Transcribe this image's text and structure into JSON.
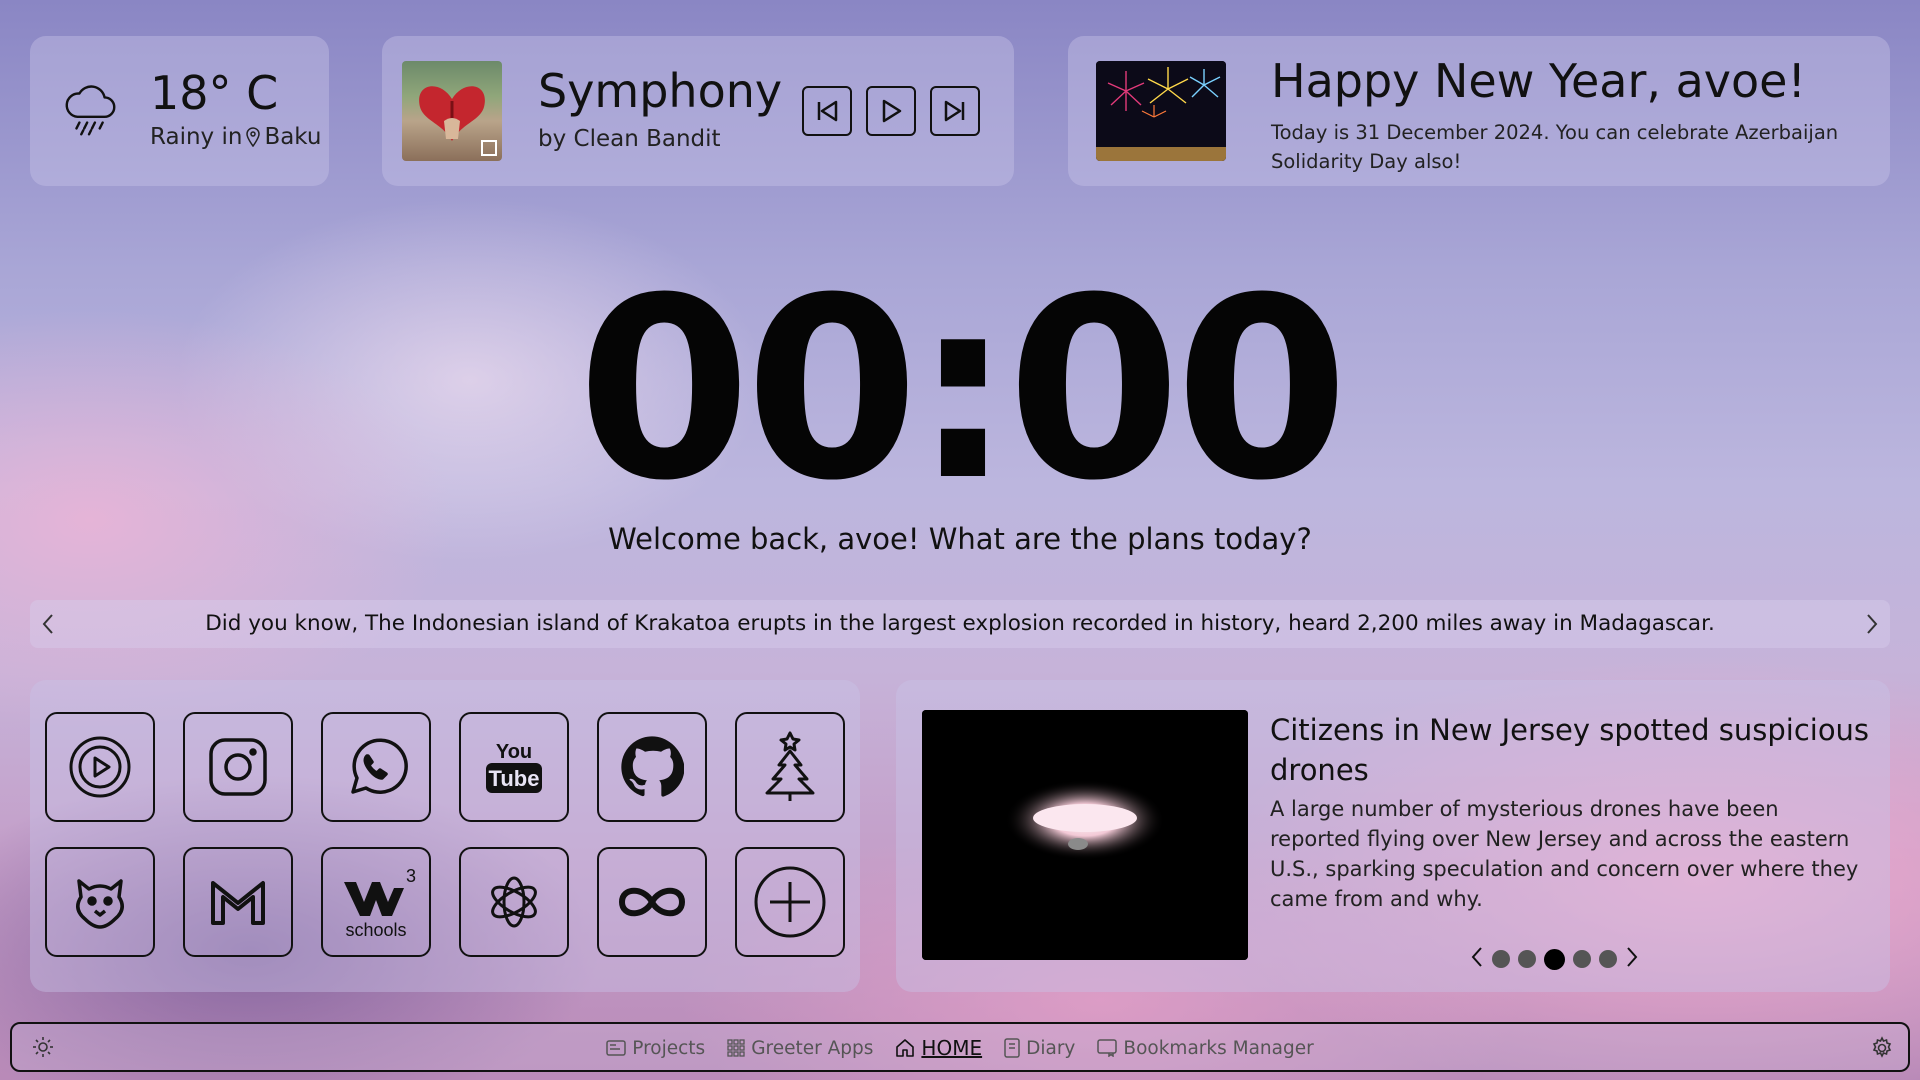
{
  "weather": {
    "temperature": "18° C",
    "condition": "Rainy in",
    "city": "Baku",
    "icon": "cloud-rain-icon"
  },
  "music": {
    "song": "Symphony",
    "artist": "by Clean Bandit",
    "controls": [
      "previous-icon",
      "play-icon",
      "next-icon"
    ]
  },
  "greeting": {
    "title": "Happy New Year, avoe!",
    "subtitle": "Today is 31 December 2024. You can celebrate Azerbaijan Solidarity Day also!"
  },
  "clock": {
    "time": "00:00",
    "welcome": "Welcome back, avoe! What are the plans today?"
  },
  "fact": {
    "text": "Did you know, The Indonesian island of Krakatoa erupts in the largest explosion recorded in history, heard 2,200 miles away in Madagascar."
  },
  "apps": {
    "row1": [
      "play-circle-icon",
      "instagram-icon",
      "whatsapp-icon",
      "youtube-icon",
      "github-icon",
      "christmas-tree-icon"
    ],
    "row2": [
      "bird-icon",
      "gmail-icon",
      "w3schools-icon",
      "openai-icon",
      "infinity-icon",
      "add-icon"
    ],
    "w3schools_label": "schools",
    "youtube_top": "You",
    "youtube_bottom": "Tube"
  },
  "news": {
    "title": "Citizens in New Jersey spotted suspicious drones",
    "body": "A large number of mysterious drones have been reported flying over New Jersey and across the eastern U.S., sparking speculation and concern over where they came from and why.",
    "page_count": 5,
    "active_page": 3
  },
  "nav": {
    "items": [
      {
        "label": "Projects",
        "icon": "projects-icon"
      },
      {
        "label": "Greeter Apps",
        "icon": "grid-icon"
      },
      {
        "label": "HOME",
        "icon": "home-icon"
      },
      {
        "label": "Diary",
        "icon": "diary-icon"
      },
      {
        "label": "Bookmarks Manager",
        "icon": "bookmarks-icon"
      }
    ],
    "active": "HOME"
  },
  "colors": {
    "foreground": "#111111",
    "card": "#c8c3e6",
    "background_top": "#8a86c4",
    "background_pink": "#f5aacd"
  }
}
